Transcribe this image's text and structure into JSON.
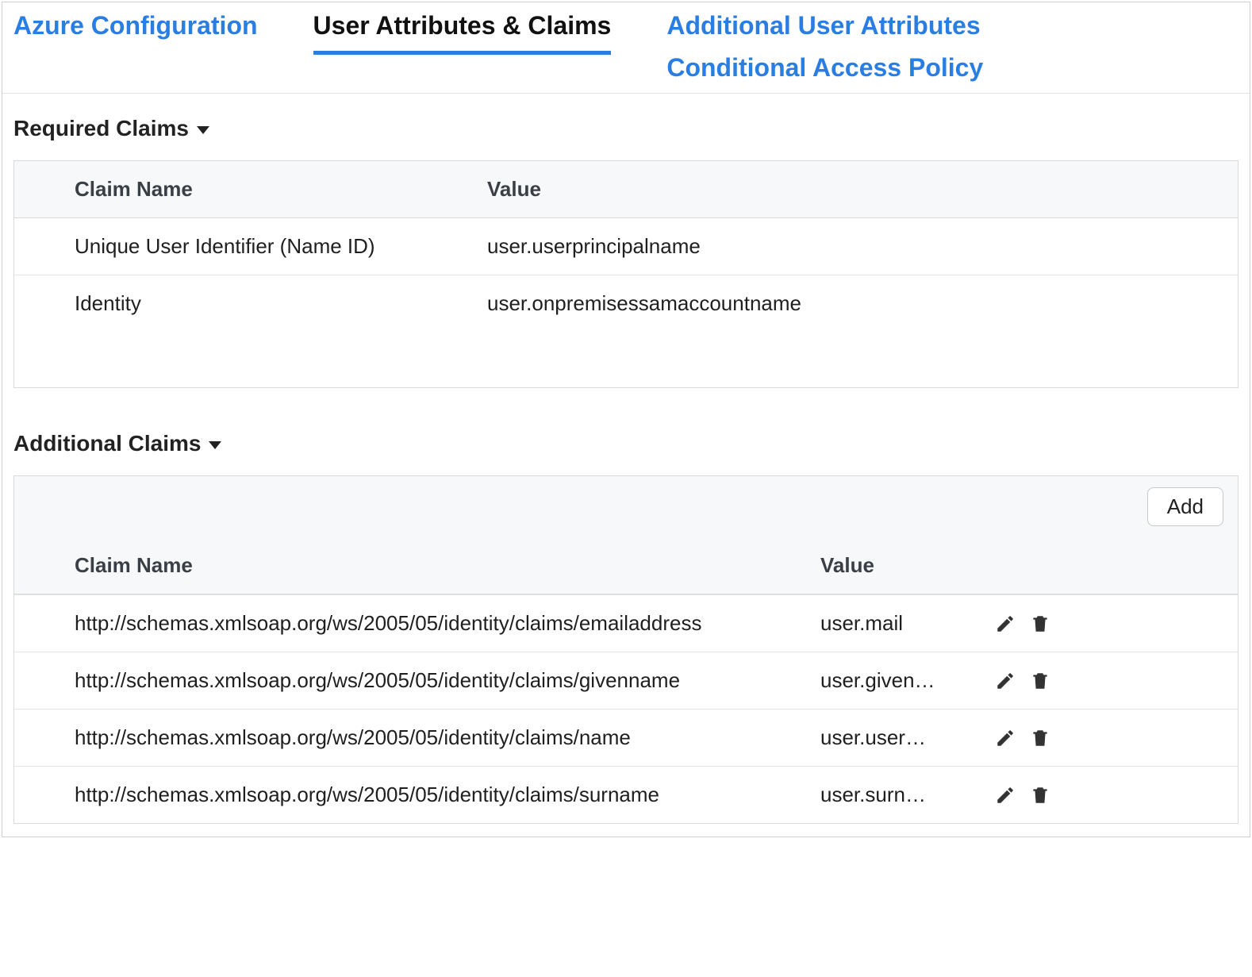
{
  "tabs": {
    "azure_config": "Azure Configuration",
    "user_attrs": "User Attributes & Claims",
    "additional_attrs": "Additional User Attributes",
    "conditional_access": "Conditional Access Policy"
  },
  "sections": {
    "required_title": "Required Claims",
    "additional_title": "Additional Claims"
  },
  "required_claims": {
    "headers": {
      "name": "Claim Name",
      "value": "Value"
    },
    "rows": [
      {
        "name": "Unique User Identifier (Name ID)",
        "value": "user.userprincipalname"
      },
      {
        "name": "Identity",
        "value": "user.onpremisessamaccountname"
      }
    ]
  },
  "additional_claims": {
    "add_button": "Add",
    "headers": {
      "name": "Claim Name",
      "value": "Value"
    },
    "rows": [
      {
        "name": "http://schemas.xmlsoap.org/ws/2005/05/identity/claims/emailaddress",
        "value": "user.mail"
      },
      {
        "name": "http://schemas.xmlsoap.org/ws/2005/05/identity/claims/givenname",
        "value": "user.given…"
      },
      {
        "name": "http://schemas.xmlsoap.org/ws/2005/05/identity/claims/name",
        "value": "user.user…"
      },
      {
        "name": "http://schemas.xmlsoap.org/ws/2005/05/identity/claims/surname",
        "value": "user.surn…"
      }
    ]
  }
}
